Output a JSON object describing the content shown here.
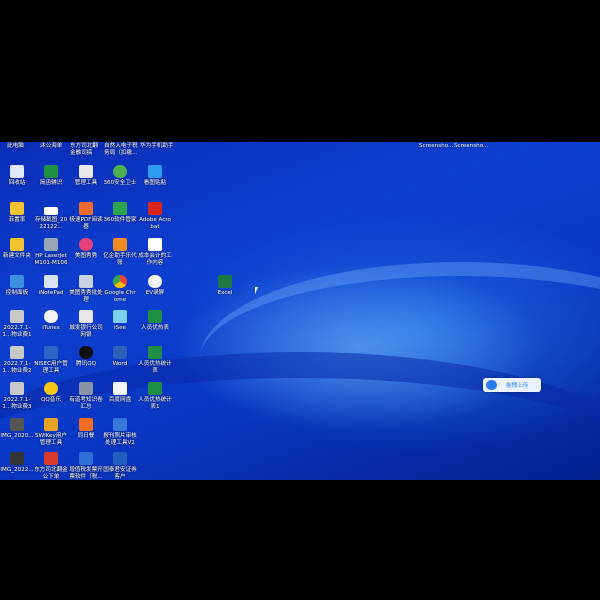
{
  "top_labels": {
    "col1": "此电脑",
    "col2": "沐公海单",
    "col3": "东方司北翻金融司搞",
    "col4": "自然入电子税务局（扣缴...",
    "col5": "华为手机助手",
    "right1": "Screensho...",
    "right2": "Screensho..."
  },
  "icons": {
    "r1c1": "回收站",
    "r1c2": "简函辅识",
    "r1c3": "管理工具",
    "r1c4": "360安全卫士",
    "r1c5": "看图贴贴",
    "r2c1": "菲置率",
    "r2c2": "存储截图_2022122...",
    "r2c3": "极速PDF阅读器",
    "r2c4": "360软件管家",
    "r2c5": "Adobe Acrobat",
    "r3c1": "新建文件夹",
    "r3c2": "HP LaserJet M101-M106",
    "r3c3": "美图秀秀",
    "r3c4": "亿企助手乐代账",
    "r3c5": "成本会计的工作内容",
    "r4c1": "控制面板",
    "r4c2": "iNotePad",
    "r4c3": "美图秀秀批处理",
    "r4c4": "Google Chrome",
    "r4c5": "EV录屏",
    "r5c1": "2022.7.1-1...物业费1",
    "r5c2": "iTunes",
    "r5c3": "城发银行公司网银",
    "r5c4": "iSee",
    "r5c5": "人员优热表",
    "r6c1": "2022.7.1-1...物业费2",
    "r6c2": "NISEC用户管理工具",
    "r6c3": "腾讯QQ",
    "r6c4": "Word",
    "r6c5": "人员优热统计表",
    "r7c1": "2022.7.1-1...物业费3",
    "r7c2": "QQ音乐",
    "r7c3": "有道考知识卷汇总",
    "r7c4": "百度网盘",
    "r7c5": "人员优热统计表1",
    "r8c1": "IMG_2020...",
    "r8c2": "SWlKey用户管理工具",
    "r8c3": "同日餐",
    "r8c4": "报刊照片审核处理工具V2",
    "r9c1": "IMG_2022...",
    "r9c2": "东方司北翻金公下单",
    "r9c3": "增值税发票开票软件（税...",
    "r9c4": "国泰君安证券客户",
    "excel": "Excel"
  },
  "upload_button": "拖拽上传",
  "colors": {
    "desktop_blue": "#0d3fd0",
    "accent": "#2a7cf0"
  }
}
